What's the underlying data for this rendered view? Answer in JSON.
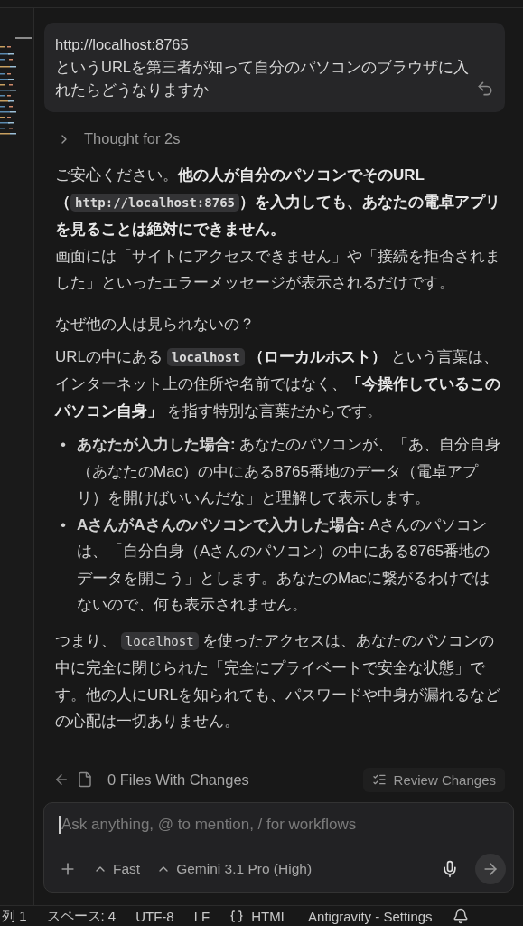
{
  "user_message": {
    "lines": [
      "http://localhost:8765",
      "というURLを第三者が知って自分のパソコンのブラウザに入れたらどうなりますか"
    ]
  },
  "thought": {
    "label": "Thought for 2s",
    "expanded": false
  },
  "answer": [
    {
      "kind": "paragraph",
      "segments": [
        {
          "kind": "text",
          "text": "ご安心ください。**他の人が自分のパソコンでそのURL（**"
        },
        {
          "kind": "code",
          "text": "http://localhost:8765",
          "bold": true
        },
        {
          "kind": "text",
          "text": "**）を入力しても、あなたの電卓アプリを見ることは絶対にできません。**"
        }
      ]
    },
    {
      "kind": "paragraph",
      "segments": [
        {
          "kind": "text",
          "text": "画面には「サイトにアクセスできません」や「接続を拒否されました」といったエラーメッセージが表示されるだけです。"
        }
      ]
    },
    {
      "kind": "heading",
      "segments": [
        {
          "kind": "text",
          "text": "なぜ他の人は見られないの？"
        }
      ]
    },
    {
      "kind": "paragraph",
      "segments": [
        {
          "kind": "text",
          "text": "URLの中にある "
        },
        {
          "kind": "code",
          "text": "localhost",
          "bold": true
        },
        {
          "kind": "text",
          "text": " **（ローカルホスト）** という言葉は、インターネット上の住所や名前ではなく、**「今操作しているこのパソコン自身」** を指す特別な言葉だからです。"
        }
      ]
    },
    {
      "kind": "bullets",
      "items": [
        {
          "marker": "•",
          "segments": [
            {
              "kind": "text",
              "text": "**あなたが入力した場合:** あなたのパソコンが、「あ、自分自身（あなたのMac）の中にある8765番地のデータ（電卓アプリ）を開けばいいんだな」と理解して表示します。"
            }
          ]
        },
        {
          "marker": "•",
          "segments": [
            {
              "kind": "text",
              "text": "**AさんがAさんのパソコンで入力した場合:** Aさんのパソコンは、「自分自身（Aさんのパソコン）の中にある8765番地のデータを開こう」とします。あなたのMacに繋がるわけではないので、何も表示されません。"
            }
          ]
        }
      ]
    },
    {
      "kind": "paragraph",
      "segments": [
        {
          "kind": "text",
          "text": "つまり、 "
        },
        {
          "kind": "code",
          "text": "localhost",
          "bold": false
        },
        {
          "kind": "text",
          "text": " を使ったアクセスは、あなたのパソコンの中に完全に閉じられた「完全にプライベートで安全な状態」です。他の人にURLを知られても、パスワードや中身が漏れるなどの心配は一切ありません。"
        }
      ]
    }
  ],
  "changes_bar": {
    "label": "0 Files With Changes",
    "review_button": "Review Changes"
  },
  "composer": {
    "placeholder": "Ask anything, @ to mention, / for workflows",
    "mode": "Fast",
    "model": "Gemini 3.1 Pro (High)"
  },
  "status_bar": [
    "列 1",
    "スペース: 4",
    "UTF-8",
    "LF",
    "HTML",
    "Antigravity - Settings"
  ]
}
